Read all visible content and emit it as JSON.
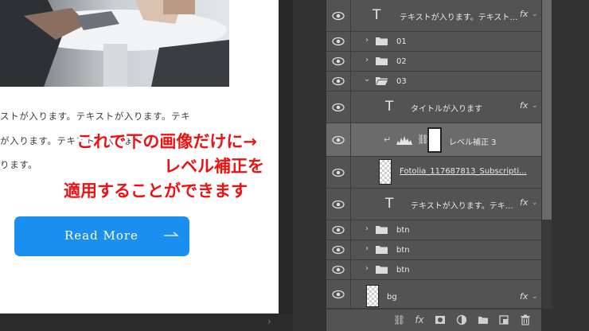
{
  "document": {
    "paragraph_lines": [
      "ストが入ります。テキストが入ります。テキ",
      "が入ります。テキストが入ります。テ",
      "ります。"
    ],
    "button": {
      "label": "Read More",
      "arrow_icon": "arrow-right-icon",
      "color": "#1b8ff0"
    }
  },
  "layers_panel": {
    "layers": [
      {
        "kind": "text",
        "name": "テキストが入ります。テキスト…",
        "fx": "fx"
      },
      {
        "kind": "group",
        "name": "01"
      },
      {
        "kind": "group",
        "name": "02"
      },
      {
        "kind": "group-open",
        "name": "03"
      },
      {
        "kind": "text",
        "name": "タイトルが入ります",
        "fx": "fx"
      },
      {
        "kind": "adjustment",
        "name": "レベル補正 3",
        "selected": true
      },
      {
        "kind": "image",
        "name": "Fotolia_117687813_Subscripti..."
      },
      {
        "kind": "text",
        "name": "テキストが入ります。テキ…",
        "fx": "fx"
      },
      {
        "kind": "group",
        "name": "btn"
      },
      {
        "kind": "group",
        "name": "btn"
      },
      {
        "kind": "group",
        "name": "btn"
      },
      {
        "kind": "image",
        "name": "bg",
        "fx": "fx"
      }
    ],
    "bottom_tools": [
      "link-icon",
      "fx-icon",
      "mask-icon",
      "adjustment-icon",
      "new-group-icon",
      "new-layer-icon",
      "trash-icon"
    ],
    "fx_label": "fx"
  },
  "annotation": {
    "line1": "これで下の画像だけに→",
    "line2": "レベル補正を",
    "line3": "適用することができます",
    "color": "#ee1111"
  }
}
